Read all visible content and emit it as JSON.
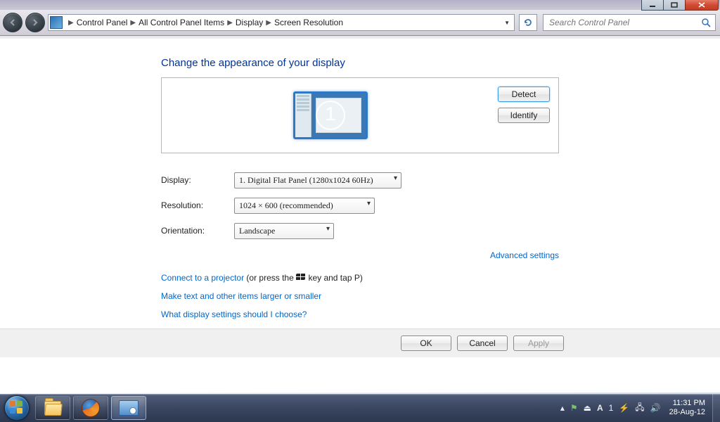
{
  "window_controls": {
    "close_tip": "Close",
    "max_tip": "Maximize",
    "min_tip": "Minimize"
  },
  "breadcrumb": {
    "seg1": "Control Panel",
    "seg2": "All Control Panel Items",
    "seg3": "Display",
    "seg4": "Screen Resolution"
  },
  "search": {
    "placeholder": "Search Control Panel"
  },
  "page": {
    "title": "Change the appearance of your display",
    "monitor_number": "1",
    "detect": "Detect",
    "identify": "Identify",
    "label_display": "Display:",
    "label_resolution": "Resolution:",
    "label_orientation": "Orientation:",
    "value_display": "1. Digital Flat Panel (1280x1024 60Hz)",
    "value_resolution": "1024 × 600 (recommended)",
    "value_orientation": "Landscape",
    "advanced": "Advanced settings",
    "projector_link": "Connect to a projector",
    "projector_tail1": " (or press the ",
    "projector_tail2": " key and tap P)",
    "textsize_link": "Make text and other items larger or smaller",
    "help_link": "What display settings should I choose?",
    "ok": "OK",
    "cancel": "Cancel",
    "apply": "Apply"
  },
  "tray": {
    "time": "11:31 PM",
    "date": "28-Aug-12",
    "lang_letter": "A",
    "lang_num": "1"
  }
}
